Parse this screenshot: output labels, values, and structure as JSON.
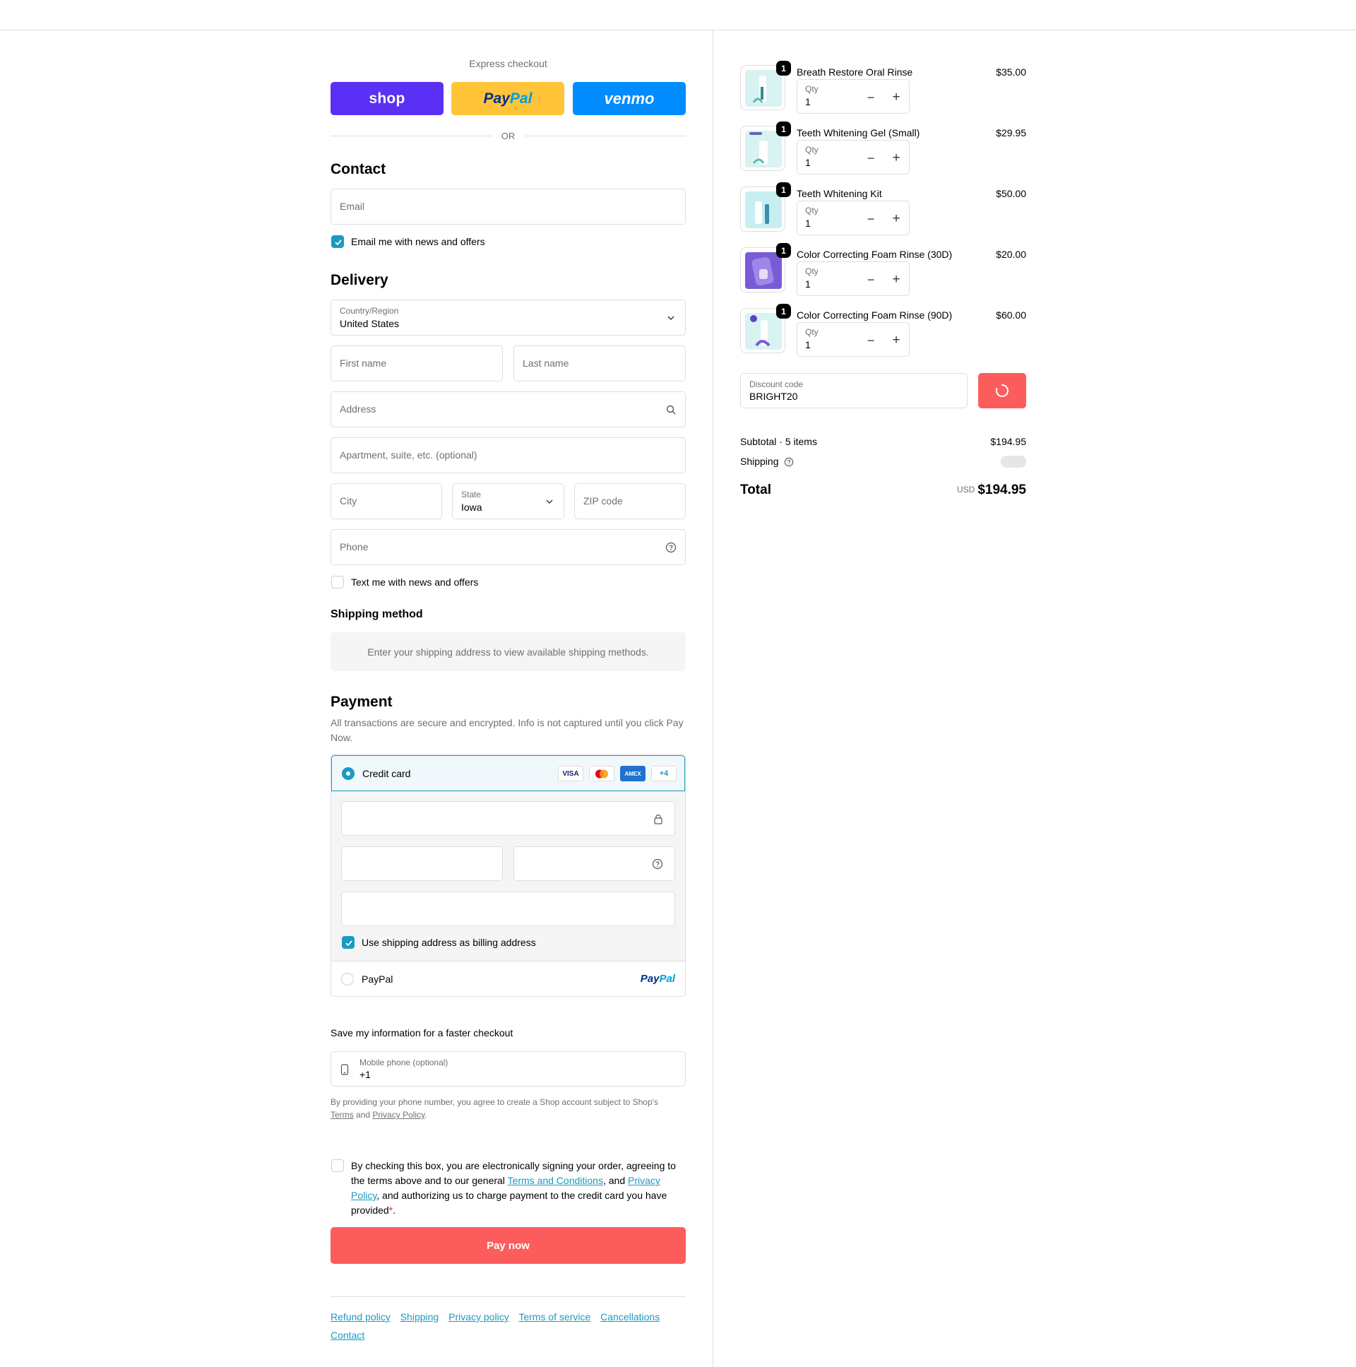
{
  "express": {
    "title": "Express checkout",
    "shop_label": "shop",
    "paypal_label_a": "Pay",
    "paypal_label_b": "Pal",
    "venmo_label": "venmo",
    "or_label": "OR"
  },
  "contact": {
    "heading": "Contact",
    "email_placeholder": "Email",
    "newsletter_label": "Email me with news and offers",
    "newsletter_checked": true
  },
  "delivery": {
    "heading": "Delivery",
    "country_label": "Country/Region",
    "country_value": "United States",
    "first_name_placeholder": "First name",
    "last_name_placeholder": "Last name",
    "address_placeholder": "Address",
    "apartment_placeholder": "Apartment, suite, etc. (optional)",
    "city_placeholder": "City",
    "state_label": "State",
    "state_value": "Iowa",
    "zip_placeholder": "ZIP code",
    "phone_placeholder": "Phone",
    "sms_label": "Text me with news and offers",
    "sms_checked": false
  },
  "shipping_method": {
    "heading": "Shipping method",
    "message": "Enter your shipping address to view available shipping methods."
  },
  "payment": {
    "heading": "Payment",
    "description": "All transactions are secure and encrypted. Info is not captured until you click Pay Now.",
    "credit_card_label": "Credit card",
    "brands": [
      "VISA",
      "AMEX",
      "+4"
    ],
    "billing_label": "Use shipping address as billing address",
    "paypal_option_label": "PayPal",
    "paypal_logo_a": "Pay",
    "paypal_logo_b": "Pal"
  },
  "save_info": {
    "title": "Save my information for a faster checkout",
    "mobile_label": "Mobile phone (optional)",
    "mobile_value": "+1",
    "legal_prefix": "By providing your phone number, you agree to create a Shop account subject to Shop's",
    "terms_link": "Terms",
    "and": "and",
    "privacy_link": "Privacy Policy"
  },
  "agreement": {
    "text_a": "By checking this box, you are electronically signing your order, agreeing to the terms above and to our general ",
    "terms_link": "Terms and Conditions",
    "text_b": ", and ",
    "privacy_link": "Privacy Policy",
    "text_c": ", and authorizing us to charge payment to the credit card you have provided",
    "required_mark": "*",
    "end": "."
  },
  "pay_now_label": "Pay now",
  "footer_links": [
    "Refund policy",
    "Shipping",
    "Privacy policy",
    "Terms of service",
    "Cancellations",
    "Contact"
  ],
  "cart": {
    "qty_label": "Qty",
    "items": [
      {
        "name": "Breath Restore Oral Rinse",
        "price": "$35.00",
        "qty": "1",
        "badge": "1"
      },
      {
        "name": "Teeth Whitening Gel (Small)",
        "price": "$29.95",
        "qty": "1",
        "badge": "1"
      },
      {
        "name": "Teeth Whitening Kit",
        "price": "$50.00",
        "qty": "1",
        "badge": "1"
      },
      {
        "name": "Color Correcting Foam Rinse (30D)",
        "price": "$20.00",
        "qty": "1",
        "badge": "1"
      },
      {
        "name": "Color Correcting Foam Rinse (90D)",
        "price": "$60.00",
        "qty": "1",
        "badge": "1"
      }
    ],
    "discount_label": "Discount code",
    "discount_value": "BRIGHT20",
    "subtotal_label": "Subtotal · 5 items",
    "subtotal_value": "$194.95",
    "shipping_label": "Shipping",
    "total_label": "Total",
    "currency": "USD",
    "total_value": "$194.95"
  },
  "colors": {
    "accent": "#1a9bc0",
    "pay_now": "#fd5c5c",
    "shop_brand": "#5a31f4",
    "paypal_brand": "#ffc439",
    "venmo_brand": "#008cff"
  }
}
